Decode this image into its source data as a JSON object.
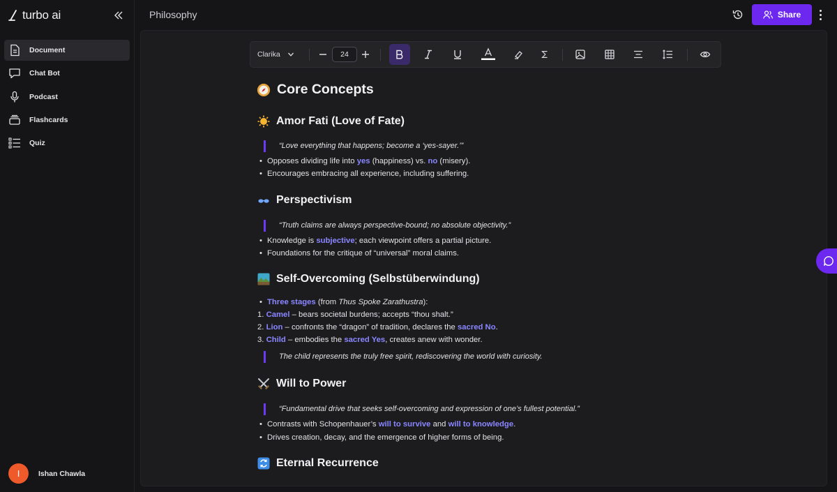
{
  "app": {
    "brand": "turbo ai",
    "page_title": "Philosophy"
  },
  "sidebar": {
    "items": [
      {
        "label": "Document",
        "icon": "document-icon",
        "active": true
      },
      {
        "label": "Chat Bot",
        "icon": "chat-bubble-icon",
        "active": false
      },
      {
        "label": "Podcast",
        "icon": "microphone-icon",
        "active": false
      },
      {
        "label": "Flashcards",
        "icon": "cards-icon",
        "active": false
      },
      {
        "label": "Quiz",
        "icon": "checklist-icon",
        "active": false
      }
    ],
    "user": {
      "initial": "I",
      "name": "Ishan Chawla"
    }
  },
  "header": {
    "share_label": "Share"
  },
  "toolbar": {
    "font": "Clarika",
    "font_size": "24"
  },
  "document": {
    "title": "Core Concepts",
    "sections": {
      "amor": {
        "heading": "Amor Fati (Love of Fate)",
        "quote": "“Love everything that happens; become a ‘yes-sayer.’”",
        "b1": {
          "pre": "Opposes dividing life into ",
          "hl1": "yes",
          "mid": " (happiness) vs. ",
          "hl2": "no",
          "post": " (misery)."
        },
        "b2": "Encourages embracing all experience, including suffering."
      },
      "persp": {
        "heading": "Perspectivism",
        "quote": "“Truth claims are always perspective-bound; no absolute objectivity.”",
        "b1": {
          "pre": "Knowledge is ",
          "hl": "subjective",
          "post": "; each viewpoint offers a partial picture."
        },
        "b2": "Foundations for the critique of “universal” moral claims."
      },
      "self": {
        "heading": "Self-Overcoming (Selbstüberwindung)",
        "b1": {
          "hl": "Three stages",
          "pre": " (from ",
          "it": "Thus Spoke Zarathustra",
          "post": "):"
        },
        "o1": {
          "num": "1.",
          "hl": "Camel",
          "post": " – bears societal burdens; accepts “thou shalt.”"
        },
        "o2": {
          "num": "2.",
          "hl": "Lion",
          "mid": " – confronts the “dragon” of tradition, declares the ",
          "hl2": "sacred No",
          "post": "."
        },
        "o3": {
          "num": "3.",
          "hl": "Child",
          "mid": " – embodies the ",
          "hl2": "sacred Yes",
          "post": ", creates anew with wonder."
        },
        "quote": "The child represents the truly free spirit, rediscovering the world with curiosity."
      },
      "will": {
        "heading": "Will to Power",
        "quote": "“Fundamental drive that seeks self-overcoming and expression of one’s fullest potential.”",
        "b1": {
          "pre": "Contrasts with Schopenhauer’s ",
          "hl1": "will to survive",
          "mid": " and ",
          "hl2": "will to knowledge",
          "post": "."
        },
        "b2": "Drives creation, decay, and the emergence of higher forms of being."
      },
      "eternal": {
        "heading": "Eternal Recurrence"
      }
    }
  },
  "colors": {
    "accent": "#6d28f0",
    "highlight": "#8a86ff",
    "quote_bar": "#6d3af2",
    "avatar": "#ef5a2b"
  }
}
